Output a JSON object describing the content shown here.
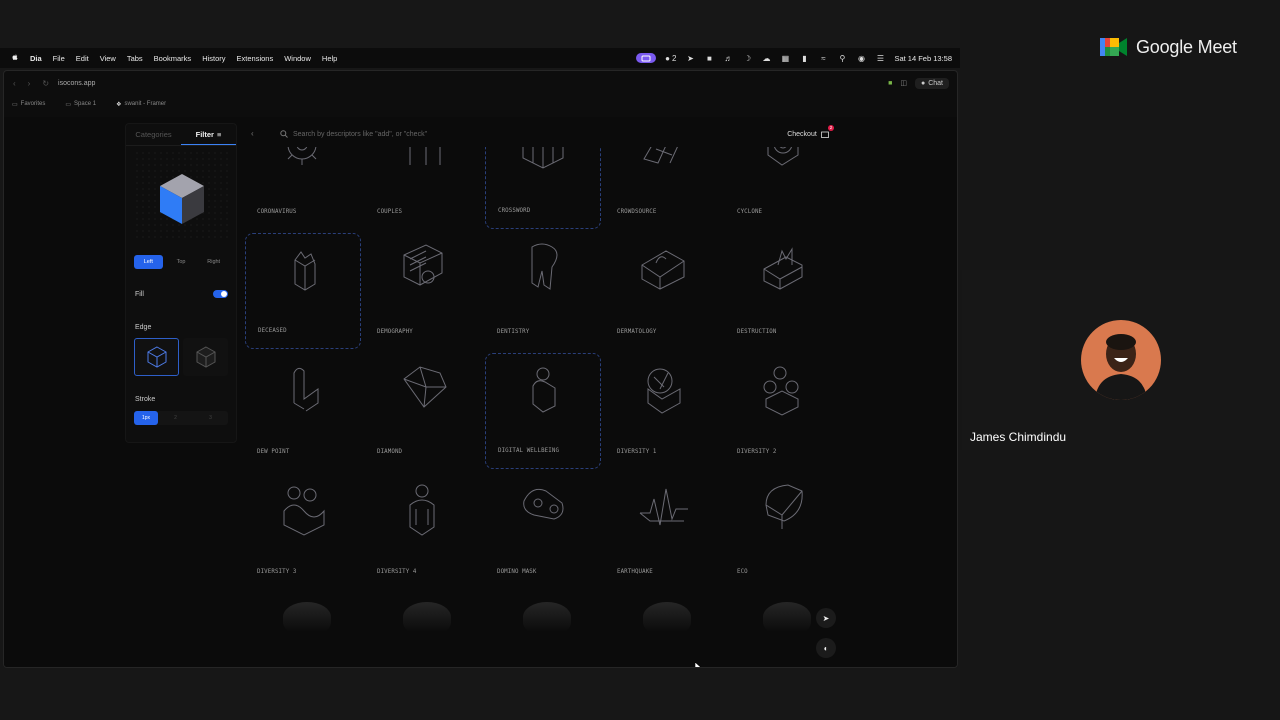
{
  "menubar": {
    "app": "Dia",
    "items": [
      "File",
      "Edit",
      "View",
      "Tabs",
      "Bookmarks",
      "History",
      "Extensions",
      "Window",
      "Help"
    ],
    "status_count": "2",
    "datetime": "Sat 14 Feb 13:58"
  },
  "browser": {
    "url": "isocons.app",
    "chat_label": "Chat",
    "favorites": [
      "Favorites",
      "Space 1",
      "swanit - Framer"
    ]
  },
  "sidebar": {
    "tab_categories": "Categories",
    "tab_filter": "Filter",
    "view_options": [
      "Left",
      "Top",
      "Right"
    ],
    "fill_label": "Fill",
    "fill_on": true,
    "edge_label": "Edge",
    "stroke_label": "Stroke",
    "stroke_options": [
      "1px",
      "2",
      "3"
    ]
  },
  "search": {
    "placeholder": "Search by descriptors like \"add\", or \"check\""
  },
  "checkout": {
    "label": "Checkout",
    "count": "2"
  },
  "icons": [
    {
      "name": "CORONAVIRUS",
      "selected": false
    },
    {
      "name": "COUPLES",
      "selected": false
    },
    {
      "name": "CROSSWORD",
      "selected": true
    },
    {
      "name": "CROWDSOURCE",
      "selected": false
    },
    {
      "name": "CYCLONE",
      "selected": false
    },
    {
      "name": "DECEASED",
      "selected": true
    },
    {
      "name": "DEMOGRAPHY",
      "selected": false
    },
    {
      "name": "DENTISTRY",
      "selected": false
    },
    {
      "name": "DERMATOLOGY",
      "selected": false
    },
    {
      "name": "DESTRUCTION",
      "selected": false
    },
    {
      "name": "DEW POINT",
      "selected": false
    },
    {
      "name": "DIAMOND",
      "selected": false
    },
    {
      "name": "DIGITAL WELLBEING",
      "selected": true
    },
    {
      "name": "DIVERSITY 1",
      "selected": false
    },
    {
      "name": "DIVERSITY 2",
      "selected": false
    },
    {
      "name": "DIVERSITY 3",
      "selected": false
    },
    {
      "name": "DIVERSITY 4",
      "selected": false
    },
    {
      "name": "DOMINO MASK",
      "selected": false
    },
    {
      "name": "EARTHQUAKE",
      "selected": false
    },
    {
      "name": "ECO",
      "selected": false
    }
  ],
  "meet": {
    "brand": "Google Meet",
    "participant": "James Chimdindu"
  }
}
